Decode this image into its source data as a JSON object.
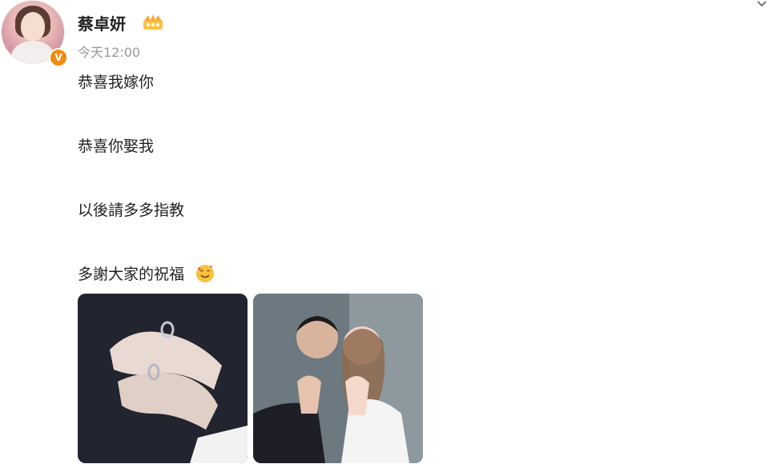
{
  "post": {
    "author": "蔡卓妍",
    "timestamp": "今天12:00",
    "lines": [
      "恭喜我嫁你",
      "恭喜你娶我",
      "以後請多多指教",
      "多謝大家的祝福"
    ],
    "images": [
      {
        "alt": "",
        "icon": "hands-rings-photo"
      },
      {
        "alt": "",
        "icon": "couple-photo"
      }
    ]
  },
  "colors": {
    "verified_badge": "#f08c10",
    "timestamp_text": "#999999"
  }
}
